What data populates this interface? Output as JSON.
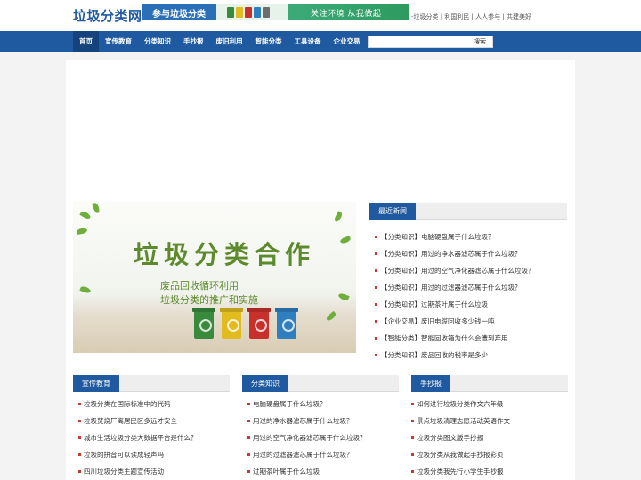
{
  "header": {
    "logo": "垃圾分类网",
    "banner_text_1": "参与垃圾分类",
    "banner_text_2": "关注环境 从我做起",
    "slogan": "-垃圾分类 | 利国利民 | 人人参与 | 共建美好"
  },
  "nav": {
    "items": [
      "首页",
      "宣传教育",
      "分类知识",
      "手抄报",
      "废旧利用",
      "智能分类",
      "工具设备",
      "企业交易"
    ]
  },
  "search": {
    "placeholder": "",
    "button": "搜索"
  },
  "slideshow": {
    "title": "垃圾分类合作",
    "subtitle_1": "废品回收循环利用",
    "subtitle_2": "垃圾分类的推广和实施",
    "bin_colors": [
      "#3a8a3d",
      "#e2bb1f",
      "#c9302c",
      "#2f7fc0"
    ]
  },
  "latest_news": {
    "heading": "最近新闻",
    "items": [
      "【分类知识】电脑硬盘属于什么垃圾？",
      "【分类知识】用过的净水器滤芯属于什么垃圾？",
      "【分类知识】用过的空气净化器滤芯属于什么垃圾？",
      "【分类知识】用过的过滤器滤芯属于什么垃圾？",
      "【分类知识】过期茶叶属于什么垃圾",
      "【企业交易】废旧电缆回收多少钱一吨",
      "【智能分类】智能回收箱为什么会遭到弃用",
      "【分类知识】废品回收的税率是多少"
    ]
  },
  "columns": [
    {
      "heading": "宣传教育",
      "items": [
        "垃圾分类在国际标准中的代码",
        "垃圾焚烧厂离居民区多远才安全",
        "城市生活垃圾分类大数据平台是什么？",
        "垃圾的拼音可以读成轻声吗",
        "四川垃圾分类主题宣传活动"
      ]
    },
    {
      "heading": "分类知识",
      "items": [
        "电脑硬盘属于什么垃圾？",
        "用过的净水器滤芯属于什么垃圾？",
        "用过的空气净化器滤芯属于什么垃圾？",
        "用过的过滤器滤芯属于什么垃圾？",
        "过期茶叶属于什么垃圾"
      ]
    },
    {
      "heading": "手抄报",
      "items": [
        "如何进行垃圾分类作文六年级",
        "景点垃圾清理志愿活动英语作文",
        "垃圾分类图文版手抄报",
        "垃圾分类从我做起手抄报彩页",
        "垃圾分类我先行小学生手抄报"
      ]
    }
  ],
  "colors": {
    "brand_blue": "#1f5aa0",
    "bullet_red": "#c9392d",
    "green": "#5d8a2d"
  }
}
